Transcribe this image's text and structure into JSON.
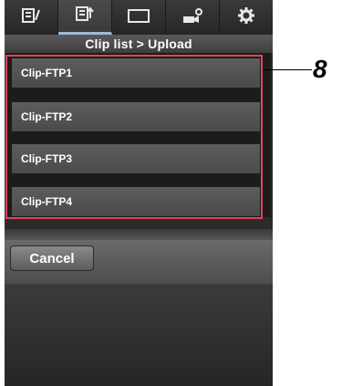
{
  "header": {
    "tabs": [
      {
        "icon": "list-edit-icon",
        "active": false
      },
      {
        "icon": "export-list-icon",
        "active": true
      },
      {
        "icon": "display-frame-icon",
        "active": false
      },
      {
        "icon": "camera-settings-icon",
        "active": false
      },
      {
        "icon": "gear-icon",
        "active": false
      }
    ],
    "title": "Clip list > Upload"
  },
  "list": {
    "items": [
      "Clip-FTP1",
      "Clip-FTP2",
      "Clip-FTP3",
      "Clip-FTP4"
    ]
  },
  "annotation": {
    "callout_number": "8",
    "color": "#e3435f"
  },
  "footer": {
    "cancel_label": "Cancel"
  }
}
